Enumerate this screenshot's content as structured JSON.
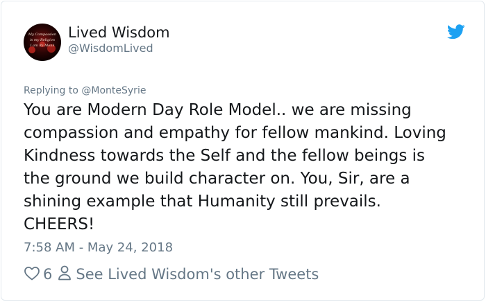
{
  "author": {
    "name": "Lived Wisdom",
    "handle": "@WisdomLived",
    "avatar_text": [
      "My Compassion",
      "is my Religion",
      "I am its Monk"
    ]
  },
  "reply": {
    "prefix": "Replying to ",
    "mention": "@MonteSyrie"
  },
  "tweet": {
    "text": "You are Modern Day Role Model.. we are missing\ncompassion and empathy for fellow mankind. Loving\nKindness towards the Self and the fellow beings is\nthe ground we build character on. You, Sir, are a\nshining example that Humanity still prevails.\nCHEERS!",
    "timestamp": "7:58 AM - May 24, 2018",
    "like_count": "6",
    "other_tweets_label": "See Lived Wisdom's other Tweets"
  },
  "icons": {
    "brand": "twitter-bird-icon",
    "like": "heart-icon",
    "profile": "person-icon"
  },
  "colors": {
    "twitter_blue": "#1da1f2",
    "secondary_text": "#657786",
    "primary_text": "#14171a",
    "border": "#e1e8ed"
  }
}
